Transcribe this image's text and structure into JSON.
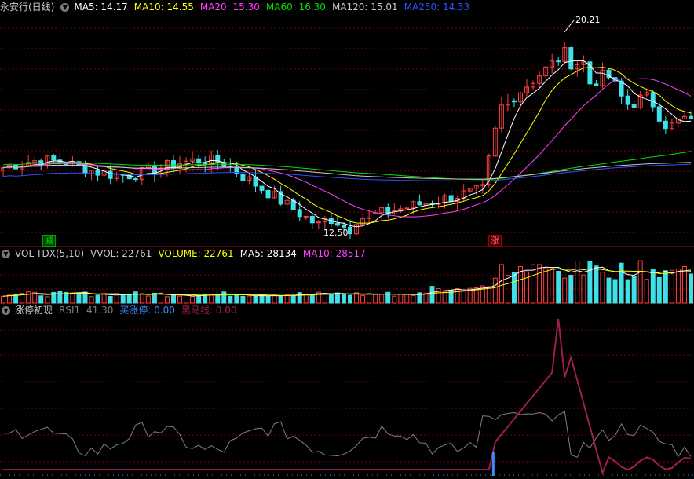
{
  "main_header": {
    "stock": "永安行(日线)",
    "toggle_icon": "chevron-down-icon",
    "items": [
      {
        "label": "MA5: 14.17",
        "color": "#ffffff"
      },
      {
        "label": "MA10: 14.55",
        "color": "#ffff00"
      },
      {
        "label": "MA20: 15.30",
        "color": "#ff40ff"
      },
      {
        "label": "MA60: 16.30",
        "color": "#00e000"
      },
      {
        "label": "MA120: 15.01",
        "color": "#c8c8c8"
      },
      {
        "label": "MA250: 14.33",
        "color": "#3050ff"
      }
    ]
  },
  "vol_header": {
    "items": [
      {
        "label": "VOL-TDX(5,10)",
        "color": "#c8c8c8"
      },
      {
        "label": "VVOL: 22761",
        "color": "#c8c8c8"
      },
      {
        "label": "VOLUME: 22761",
        "color": "#ffff00"
      },
      {
        "label": "MA5: 28134",
        "color": "#ffffff"
      },
      {
        "label": "MA10: 28517",
        "color": "#ff40ff"
      }
    ]
  },
  "ind_header": {
    "name": "涨停初现",
    "items": [
      {
        "label": "RSI1: 41.30",
        "color": "#808080"
      },
      {
        "label": "买涨停: 0.00",
        "color": "#3a8cff"
      },
      {
        "label": "黑马线: 0.00",
        "color": "#a0204a"
      }
    ]
  },
  "annotations": {
    "high": "20.21",
    "low": "12.50",
    "jian": "减",
    "zhang": "涨"
  },
  "colors": {
    "up": "#ff4040",
    "down": "#40e0e8",
    "grid": "#800000",
    "sep": "#b00000"
  },
  "chart_data": [
    {
      "type": "candlestick",
      "title": "",
      "price_range": [
        11.8,
        21.3
      ],
      "highlight": {
        "high": 20.21,
        "low": 12.5
      },
      "series": [
        {
          "name": "MA5",
          "color": "#ffffff",
          "value": 14.17
        },
        {
          "name": "MA10",
          "color": "#ffff00",
          "value": 14.55
        },
        {
          "name": "MA20",
          "color": "#ff40ff",
          "value": 15.3
        },
        {
          "name": "MA60",
          "color": "#00e000",
          "value": 16.3
        },
        {
          "name": "MA120",
          "color": "#c8c8c8",
          "value": 15.01
        },
        {
          "name": "MA250",
          "color": "#3050ff",
          "value": 14.33
        }
      ]
    },
    {
      "type": "bar",
      "title": "",
      "values_latest": {
        "VVOL": 22761,
        "VOLUME": 22761,
        "MA5": 28134,
        "MA10": 28517
      }
    },
    {
      "type": "line",
      "title": "",
      "latest": {
        "RSI1": 41.3,
        "买涨停": 0.0,
        "黑马线": 0.0
      }
    }
  ]
}
